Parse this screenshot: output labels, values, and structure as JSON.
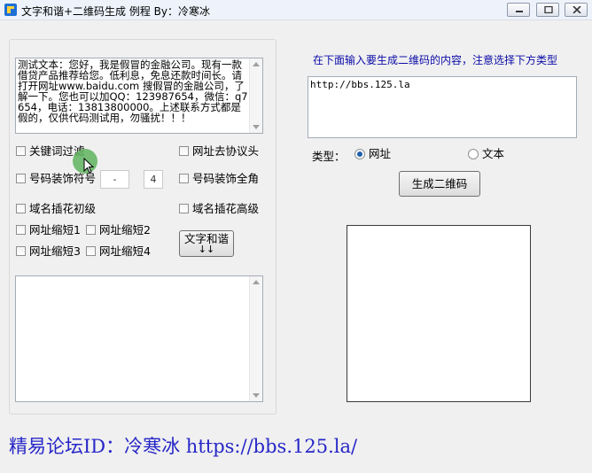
{
  "window": {
    "title": "文字和谐+二维码生成 例程  By：冷寒冰"
  },
  "left": {
    "sample_text": "测试文本：您好，我是假冒的金融公司。现有一款借贷产品推荐给您。低利息，免息还款时间长。请打开网址www.baidu.com 搜假冒的金融公司，了解一下。您也可以加QQ：123987654，微信：q7654，电话：13813800000。上述联系方式都是假的，仅供代码测试用，勿骚扰！！！",
    "options": {
      "keyword_filter": "关键词过滤",
      "url_remove_protocol": "网址去协议头",
      "number_decorate": "号码装饰符号",
      "number_fullwidth": "号码装饰全角",
      "domain_flower_basic": "域名插花初级",
      "domain_flower_advanced": "域名插花高级",
      "url_short1": "网址缩短1",
      "url_short2": "网址缩短2",
      "url_short3": "网址缩短3",
      "url_short4": "网址缩短4"
    },
    "spin_dash": "-",
    "spin_value": "4",
    "harmonize_button": "文字和谐",
    "harmonize_arrows": "↓↓",
    "output_text": ""
  },
  "right": {
    "instruction": "在下面输入要生成二维码的内容，注意选择下方类型",
    "url_value": "http://bbs.125.la",
    "type_label": "类型：",
    "type_url": "网址",
    "type_text": "文本",
    "type_selected": "url",
    "generate_button": "生成二维码"
  },
  "footer": {
    "text": "精易论坛ID：冷寒冰 https://bbs.125.la/"
  },
  "colors": {
    "instruction": "#0c0ca8",
    "footer": "#2626c8",
    "cursor_highlight": "#5fb35f"
  },
  "icons": {
    "app": "app-icon",
    "minimize": "minimize-icon",
    "maximize": "maximize-icon",
    "close": "close-icon"
  }
}
